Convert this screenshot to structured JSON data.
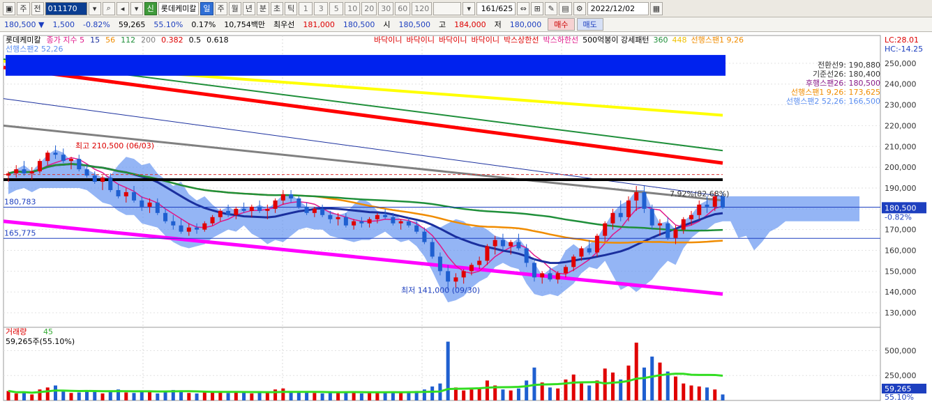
{
  "toolbar": {
    "period_label": "주",
    "prev_label": "전",
    "code": "011170",
    "stock_name": "롯데케미칼",
    "credit_label": "신",
    "tabs": [
      "일",
      "주",
      "월",
      "년",
      "분",
      "초",
      "틱"
    ],
    "numbers": [
      "1",
      "3",
      "5",
      "10",
      "20",
      "30",
      "60",
      "120"
    ],
    "count": "161",
    "total": "/625",
    "date": "2022/12/02"
  },
  "quote": {
    "price": "180,500",
    "change": "1,500",
    "change_pct": "-0.82%",
    "volume": "59,265",
    "volume_ratio": "55.10%",
    "turnover_pct": "0.17%",
    "amount": "10,754백만",
    "best_label": "최우선",
    "best_ask": "181,000",
    "best_bid": "180,500",
    "open_label": "시",
    "open": "180,500",
    "high_label": "고",
    "high": "184,000",
    "low_label": "저",
    "low": "180,000",
    "buy_label": "매수",
    "sell_label": "매도"
  },
  "colors": {
    "up": "#e00000",
    "down": "#1f5fd0",
    "ma5": "#e0188a",
    "ma15": "#1a2f9e",
    "ma56": "#f08c00",
    "ma112": "#1f8f3a",
    "ma200": "#808080",
    "envelope": "#ff00ff",
    "box_upper": "#ff0000",
    "box_lower": "#ffff00",
    "cloud": "#5b8ef0"
  },
  "chart_data": {
    "type": "candlestick",
    "price_axis": [
      250000,
      240000,
      230000,
      220000,
      210000,
      200000,
      190000,
      180000,
      170000,
      160000,
      150000,
      140000,
      130000
    ],
    "price_axis_labels": [
      "250,000",
      "240,000",
      "230,000",
      "220,000",
      "210,000",
      "200,000",
      "190,000",
      "180,000",
      "170,000",
      "160,000",
      "150,000",
      "140,000",
      "130,000"
    ],
    "ylim": [
      124000,
      260000
    ],
    "volume_axis_labels": [
      "500,000",
      "250,000"
    ],
    "volume_ylim": [
      0,
      650000
    ],
    "legend_price": [
      {
        "text": "롯데케미칼",
        "color": "#000"
      },
      {
        "text": "종가 지수 5",
        "color": "#e0188a"
      },
      {
        "text": "15",
        "color": "#1a2f9e"
      },
      {
        "text": "56",
        "color": "#f08c00"
      },
      {
        "text": "112",
        "color": "#1f8f3a"
      },
      {
        "text": "200",
        "color": "#808080"
      },
      {
        "text": "0.382",
        "color": "#d00"
      },
      {
        "text": "0.5",
        "color": "#000"
      },
      {
        "text": "0.618",
        "color": "#000"
      }
    ],
    "legend_right": [
      {
        "text": "바닥이니",
        "color": "#d00"
      },
      {
        "text": "바닥이니",
        "color": "#d00"
      },
      {
        "text": "바닥이니",
        "color": "#d00"
      },
      {
        "text": "바닥이니",
        "color": "#d00"
      },
      {
        "text": "박스상한선",
        "color": "#d00"
      },
      {
        "text": "박스하한선",
        "color": "#e0188a"
      },
      {
        "text": "500억봉이 강세패턴",
        "color": "#000"
      },
      {
        "text": "360",
        "color": "#1f8f3a"
      },
      {
        "text": "448",
        "color": "#f0c000"
      },
      {
        "text": "선행스팬1 9,26",
        "color": "#f08c00"
      }
    ],
    "legend_second_line": "선행스팬2 52,26",
    "lc_label": "LC:28.01",
    "hc_label": "HC:-14.25",
    "ichimoku_labels": [
      {
        "text": "전환선9: 190,880",
        "color": "#333"
      },
      {
        "text": "기준선26: 180,400",
        "color": "#333"
      },
      {
        "text": "후행스팬26: 180,500",
        "color": "#8a1b8a"
      },
      {
        "text": "선행스팬1 9,26: 173,625",
        "color": "#f08c00"
      },
      {
        "text": "선행스팬2 52,26: 166,500",
        "color": "#5b8ef0"
      }
    ],
    "high_annotation": "최고 210,500 (06/03)",
    "low_annotation": "최저 141,000 (09/30)",
    "change_annotation": "7.92%(82.68%)",
    "ref_line_upper": 180783,
    "ref_line_upper_label": "180,783",
    "ref_line_lower": 165775,
    "ref_line_lower_label": "165,775",
    "current_price": 180500,
    "current_price_label": "180,500",
    "current_change_label": "-0.82%",
    "box_top": 194000,
    "volume_title": "거래량",
    "volume_ma": "45",
    "volume_info": "59,265주(55.10%)",
    "current_volume_label": "59,265",
    "current_volume_ratio": "55.10%",
    "candles": [
      [
        196000,
        198000,
        193000,
        197000
      ],
      [
        197000,
        201000,
        195000,
        199000
      ],
      [
        199000,
        203000,
        196000,
        197000
      ],
      [
        197000,
        200000,
        194000,
        198000
      ],
      [
        198000,
        204000,
        197000,
        203000
      ],
      [
        203000,
        208000,
        201000,
        207000
      ],
      [
        207000,
        210500,
        204000,
        206000
      ],
      [
        206000,
        209000,
        202000,
        203000
      ],
      [
        203000,
        205000,
        199000,
        204000
      ],
      [
        204000,
        206000,
        198000,
        199000
      ],
      [
        199000,
        201000,
        195000,
        196000
      ],
      [
        196000,
        198000,
        192000,
        193000
      ],
      [
        193000,
        196000,
        189000,
        195000
      ],
      [
        195000,
        197000,
        188000,
        189000
      ],
      [
        189000,
        192000,
        185000,
        186000
      ],
      [
        186000,
        190000,
        183000,
        188000
      ],
      [
        188000,
        191000,
        183000,
        184000
      ],
      [
        184000,
        186000,
        179000,
        181000
      ],
      [
        181000,
        185000,
        178000,
        183000
      ],
      [
        183000,
        185000,
        177000,
        178000
      ],
      [
        178000,
        180000,
        173000,
        174000
      ],
      [
        174000,
        177000,
        170000,
        172000
      ],
      [
        172000,
        175000,
        168000,
        169000
      ],
      [
        169000,
        173000,
        167000,
        171000
      ],
      [
        171000,
        173000,
        168000,
        170000
      ],
      [
        170000,
        174000,
        169000,
        173000
      ],
      [
        173000,
        177000,
        172000,
        176000
      ],
      [
        176000,
        180000,
        174000,
        179000
      ],
      [
        179000,
        182000,
        176000,
        177000
      ],
      [
        177000,
        181000,
        175000,
        180000
      ],
      [
        180000,
        183000,
        178000,
        179000
      ],
      [
        179000,
        182000,
        176000,
        181000
      ],
      [
        181000,
        184000,
        178000,
        179000
      ],
      [
        179000,
        182000,
        175000,
        180000
      ],
      [
        180000,
        185000,
        178000,
        184000
      ],
      [
        184000,
        189000,
        182000,
        187000
      ],
      [
        187000,
        189000,
        183000,
        185000
      ],
      [
        185000,
        186000,
        180000,
        181000
      ],
      [
        181000,
        183000,
        177000,
        178000
      ],
      [
        178000,
        181000,
        176000,
        180000
      ],
      [
        180000,
        182000,
        176000,
        177000
      ],
      [
        177000,
        179000,
        173000,
        175000
      ],
      [
        175000,
        178000,
        172000,
        176000
      ],
      [
        176000,
        178000,
        171000,
        172000
      ],
      [
        172000,
        175000,
        170000,
        174000
      ],
      [
        174000,
        176000,
        171000,
        173000
      ],
      [
        173000,
        176000,
        171000,
        175000
      ],
      [
        175000,
        178000,
        173000,
        177000
      ],
      [
        177000,
        180000,
        175000,
        176000
      ],
      [
        176000,
        178000,
        172000,
        173000
      ],
      [
        173000,
        175000,
        170000,
        174000
      ],
      [
        174000,
        176000,
        171000,
        172000
      ],
      [
        172000,
        174000,
        168000,
        169000
      ],
      [
        169000,
        171000,
        163000,
        164000
      ],
      [
        164000,
        166000,
        156000,
        157000
      ],
      [
        157000,
        159000,
        148000,
        150000
      ],
      [
        150000,
        153000,
        141000,
        145000
      ],
      [
        145000,
        149000,
        142000,
        147000
      ],
      [
        147000,
        151000,
        144000,
        150000
      ],
      [
        150000,
        154000,
        148000,
        153000
      ],
      [
        153000,
        157000,
        151000,
        155000
      ],
      [
        155000,
        163000,
        153000,
        162000
      ],
      [
        162000,
        167000,
        158000,
        165000
      ],
      [
        165000,
        168000,
        160000,
        162000
      ],
      [
        162000,
        165000,
        158000,
        164000
      ],
      [
        164000,
        168000,
        160000,
        161000
      ],
      [
        161000,
        163000,
        152000,
        154000
      ],
      [
        154000,
        156000,
        145000,
        147000
      ],
      [
        147000,
        150000,
        144000,
        149000
      ],
      [
        149000,
        152000,
        145000,
        146000
      ],
      [
        146000,
        150000,
        144000,
        149000
      ],
      [
        149000,
        153000,
        147000,
        152000
      ],
      [
        152000,
        158000,
        150000,
        157000
      ],
      [
        157000,
        162000,
        155000,
        161000
      ],
      [
        161000,
        165000,
        158000,
        159000
      ],
      [
        159000,
        168000,
        157000,
        167000
      ],
      [
        167000,
        174000,
        164000,
        173000
      ],
      [
        173000,
        180000,
        170000,
        178000
      ],
      [
        178000,
        184000,
        174000,
        176000
      ],
      [
        176000,
        186000,
        174000,
        184000
      ],
      [
        184000,
        191000,
        179000,
        188000
      ],
      [
        188000,
        191000,
        178000,
        180000
      ],
      [
        180000,
        182000,
        170000,
        172000
      ],
      [
        172000,
        175000,
        167000,
        173000
      ],
      [
        173000,
        176000,
        165000,
        166000
      ],
      [
        166000,
        172000,
        163000,
        170000
      ],
      [
        170000,
        176000,
        168000,
        175000
      ],
      [
        175000,
        179000,
        172000,
        177000
      ],
      [
        177000,
        184000,
        175000,
        182000
      ],
      [
        182000,
        186000,
        178000,
        181000
      ],
      [
        181000,
        188000,
        179000,
        186000
      ],
      [
        186000,
        188000,
        180000,
        180500
      ]
    ],
    "volumes": [
      95000,
      70000,
      85000,
      60000,
      110000,
      130000,
      150000,
      90000,
      75000,
      80000,
      100000,
      85000,
      70000,
      95000,
      110000,
      80000,
      75000,
      90000,
      85000,
      70000,
      95000,
      105000,
      90000,
      75000,
      70000,
      80000,
      85000,
      90000,
      75000,
      80000,
      85000,
      70000,
      75000,
      80000,
      110000,
      120000,
      85000,
      80000,
      90000,
      75000,
      70000,
      80000,
      75000,
      85000,
      80000,
      70000,
      75000,
      80000,
      85000,
      90000,
      75000,
      80000,
      95000,
      110000,
      140000,
      170000,
      590000,
      130000,
      100000,
      110000,
      120000,
      200000,
      150000,
      110000,
      100000,
      120000,
      200000,
      330000,
      180000,
      130000,
      120000,
      210000,
      260000,
      170000,
      150000,
      200000,
      320000,
      280000,
      210000,
      350000,
      580000,
      330000,
      440000,
      380000,
      290000,
      240000,
      170000,
      150000,
      140000,
      130000,
      110000,
      60000
    ]
  }
}
